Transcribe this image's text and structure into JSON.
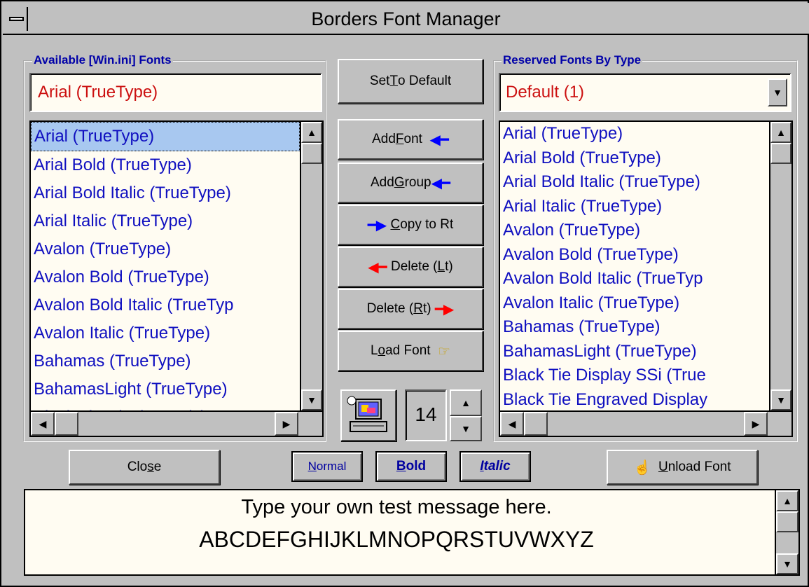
{
  "window": {
    "title": "Borders Font Manager"
  },
  "left_panel": {
    "label": "Available [Win.ini] Fonts",
    "field_value": "Arial (TrueType)",
    "items": [
      "Arial (TrueType)",
      "Arial Bold (TrueType)",
      "Arial Bold Italic (TrueType)",
      "Arial Italic (TrueType)",
      "Avalon (TrueType)",
      "Avalon Bold (TrueType)",
      "Avalon Bold Italic (TrueTyp",
      "Avalon Italic (TrueType)",
      "Bahamas (TrueType)",
      "BahamasLight (TrueType)",
      "Black Tie Display SSi (T"
    ]
  },
  "right_panel": {
    "label": "Reserved Fonts By Type",
    "combo_value": "Default (1)",
    "items": [
      "Arial (TrueType)",
      "Arial Bold (TrueType)",
      "Arial Bold Italic (TrueType)",
      "Arial Italic (TrueType)",
      "Avalon (TrueType)",
      "Avalon Bold (TrueType)",
      "Avalon Bold Italic (TrueTyp",
      "Avalon Italic (TrueType)",
      "Bahamas (TrueType)",
      "BahamasLight (TrueType)",
      "Black Tie Display SSi (True",
      "Black Tie Engraved Display"
    ]
  },
  "buttons": {
    "set_default": {
      "pre": "Set ",
      "key": "T",
      "post": "o Default"
    },
    "add_font": {
      "pre": "Add ",
      "key": "F",
      "post": "ont"
    },
    "add_group": {
      "pre": "Add ",
      "key": "G",
      "post": "roup"
    },
    "copy_rt": {
      "pre": "",
      "key": "C",
      "post": "opy to Rt"
    },
    "delete_lt": {
      "pre": "Delete (",
      "key": "L",
      "post": "t)"
    },
    "delete_rt": {
      "pre": "Delete (",
      "key": "R",
      "post": "t)"
    },
    "load_font": {
      "pre": "L",
      "key": "o",
      "post": "ad Font"
    },
    "close": {
      "pre": "Clo",
      "key": "s",
      "post": "e"
    },
    "normal": {
      "pre": "",
      "key": "N",
      "post": "ormal"
    },
    "bold": {
      "pre": "",
      "key": "B",
      "post": "old"
    },
    "italic": {
      "pre": "",
      "key": "I",
      "post": "talic"
    },
    "unload": {
      "pre": "",
      "key": "U",
      "post": "nload Font"
    }
  },
  "size_spinner": {
    "value": "14"
  },
  "message": {
    "line1": "Type your own test message here.",
    "line2": "ABCDEFGHIJKLMNOPQRSTUVWXYZ"
  },
  "icons": {
    "arrow_left": "blue-left-arrow-icon",
    "arrow_right": "blue-right-arrow-icon",
    "pointing_hand": "pointing-hand-icon",
    "unload_hand": "hand-icon",
    "computer": "computer-icon"
  },
  "colors": {
    "list_text": "#1010c0",
    "field_text": "#cc1010",
    "label_text": "#0000a8",
    "selection": "#a8c8f0"
  }
}
